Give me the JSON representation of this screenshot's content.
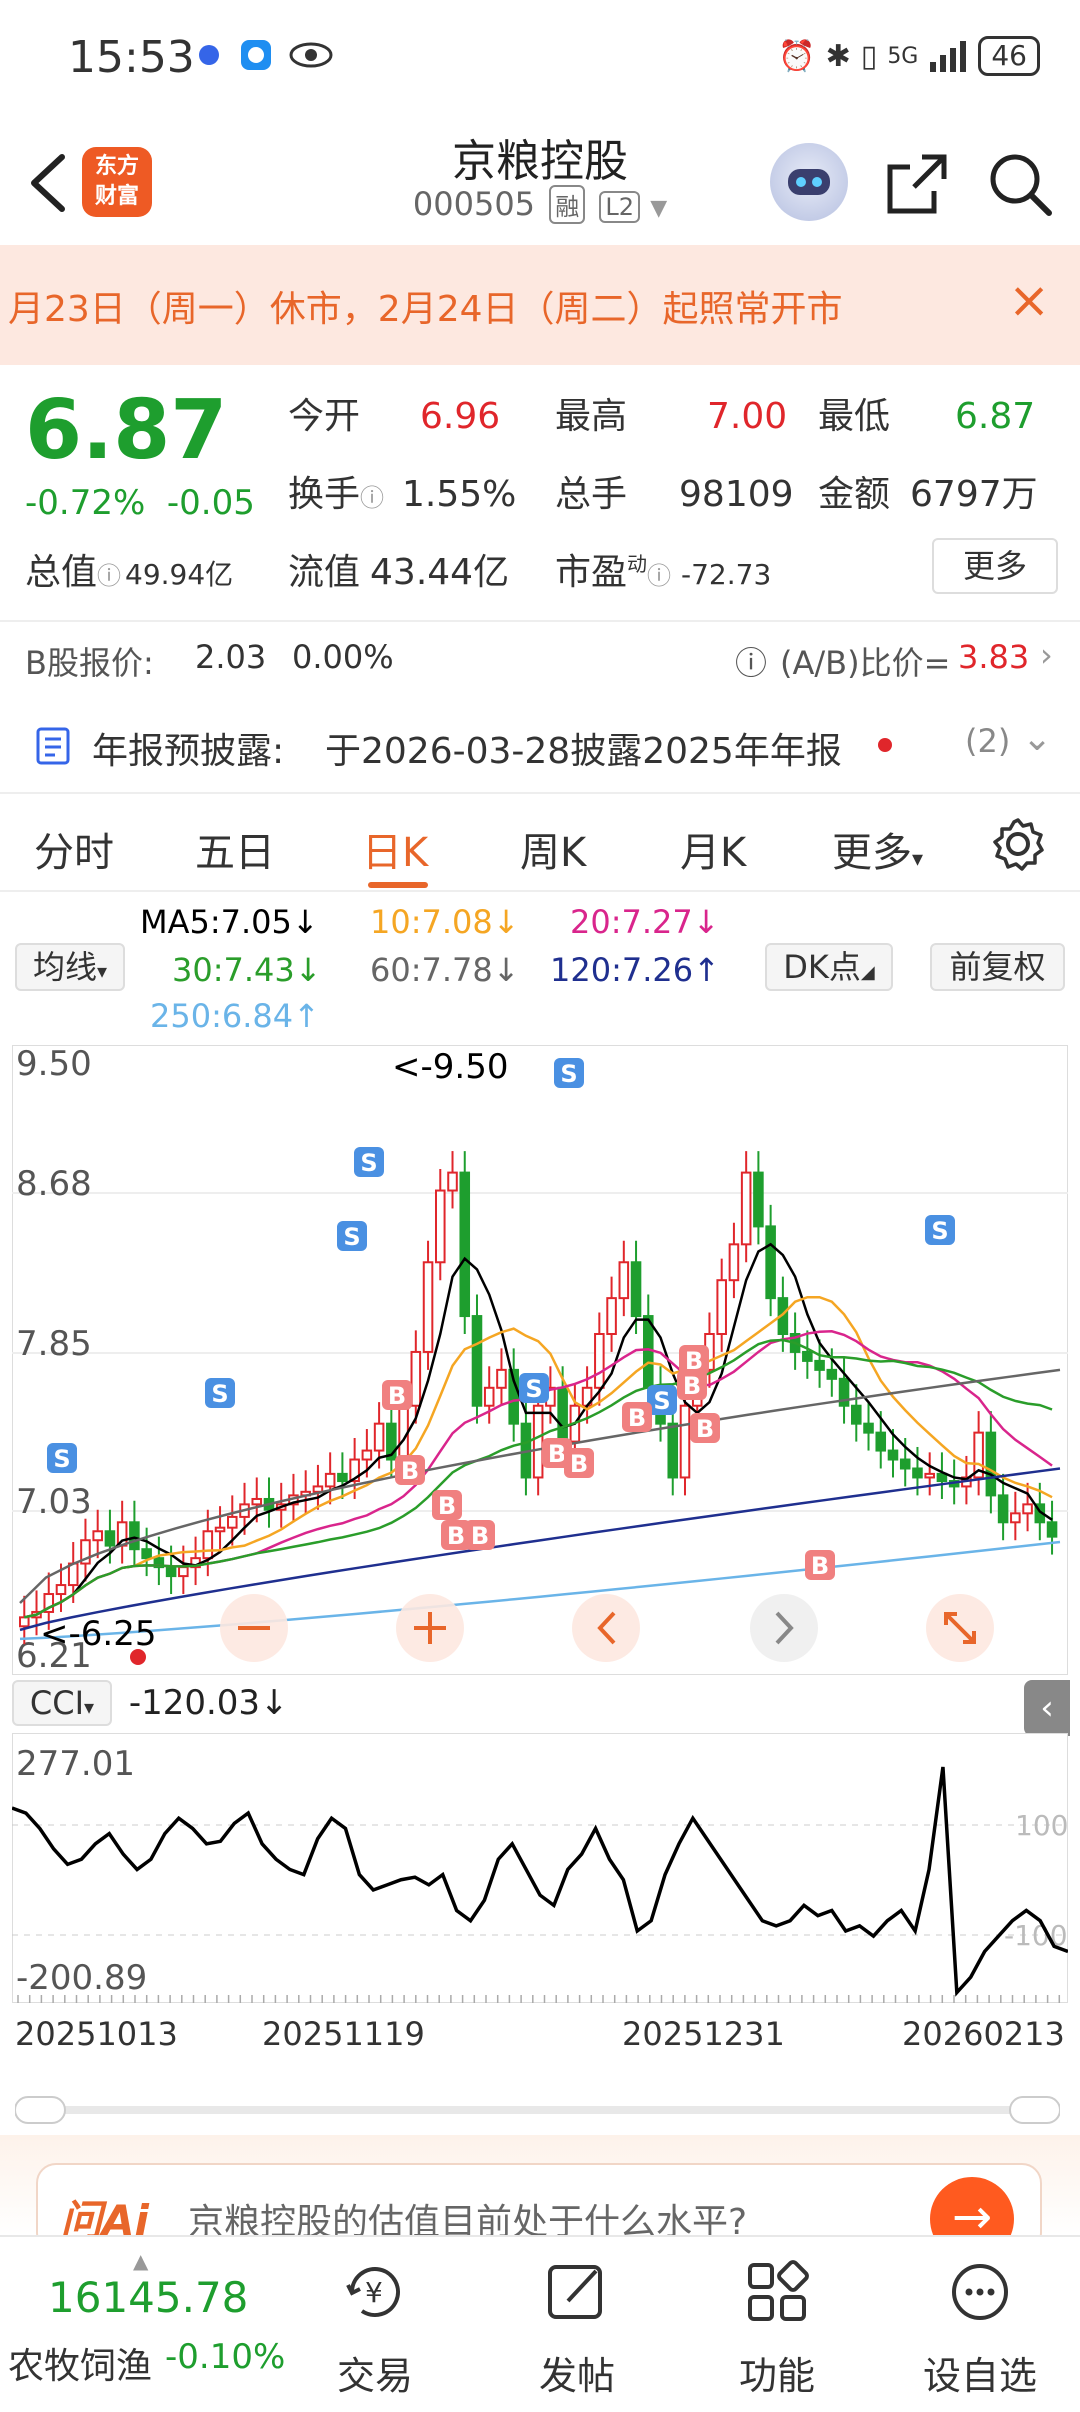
{
  "status": {
    "time": "15:53",
    "network": "5G",
    "battery": "46"
  },
  "header": {
    "logo_line1": "东方",
    "logo_line2": "财富",
    "title": "京粮控股",
    "code": "000505",
    "tag_rong": "融",
    "tag_l2": "L2"
  },
  "notice": {
    "text": "月23日（周一）休市，2月24日（周二）起照常开市",
    "close": "×"
  },
  "quote": {
    "price": "6.87",
    "change_pct": "-0.72%",
    "change": "-0.05",
    "open_label": "今开",
    "open": "6.96",
    "high_label": "最高",
    "high": "7.00",
    "low_label": "最低",
    "low": "6.87",
    "turnover_label": "换手",
    "turnover": "1.55%",
    "volume_label": "总手",
    "volume": "98109",
    "amount_label": "金额",
    "amount": "6797万",
    "mcap_label": "总值",
    "mcap": "49.94亿",
    "float_label": "流值",
    "float": "43.44亿",
    "pe_label": "市盈",
    "pe_sup": "动",
    "pe": "-72.73",
    "more": "更多"
  },
  "bshare": {
    "label": "B股报价:",
    "price": "2.03",
    "pct": "0.00%",
    "ratio_label": "(A/B)比价=",
    "ratio": "3.83"
  },
  "annual": {
    "label": "年报预披露:",
    "text": "于2026-03-28披露2025年年报",
    "count": "(2)"
  },
  "tabs": [
    "分时",
    "五日",
    "日K",
    "周K",
    "月K",
    "更多"
  ],
  "ma": {
    "selector": "均线",
    "ma5": "MA5:7.05↓",
    "ma10": "10:7.08↓",
    "ma20": "20:7.27↓",
    "ma30": "30:7.43↓",
    "ma60": "60:7.78↓",
    "ma120": "120:7.26↑",
    "ma250": "250:6.84↑",
    "dk": "DK点",
    "adjust": "前复权"
  },
  "chart": {
    "y_labels": [
      "9.50",
      "8.68",
      "7.85",
      "7.03",
      "6.21"
    ],
    "max_note": "<-9.50",
    "min_note": "<-6.25",
    "colors": {
      "up": "#e0262b",
      "down": "#1e9e2e",
      "ma5": "#000000",
      "ma10": "#f5a623",
      "ma20": "#d9258c",
      "ma30": "#2a9d2a",
      "ma60": "#666666",
      "ma120": "#1f2f8f",
      "ma250": "#6ab4e8"
    }
  },
  "chart_data": {
    "type": "candlestick",
    "ylim": [
      6.21,
      9.5
    ],
    "y_ticks": [
      9.5,
      8.68,
      7.85,
      7.03,
      6.21
    ],
    "x_ticks": [
      "20251013",
      "20251119",
      "20251231",
      "20260213"
    ],
    "high": 9.5,
    "low": 6.25,
    "last_close": 6.87
  },
  "cci": {
    "selector": "CCI",
    "value": "-120.03↓",
    "top": "277.01",
    "bottom": "-200.89",
    "ref_hi": "100",
    "ref_lo": "-100"
  },
  "dates": [
    "20251013",
    "20251119",
    "20251231",
    "20260213"
  ],
  "ai": {
    "logo": "问Ai",
    "question": "京粮控股的估值目前处于什么水平?"
  },
  "bottom": {
    "index_value": "16145.78",
    "index_name": "农牧饲渔",
    "index_change": "-0.10%",
    "nav": [
      "交易",
      "发帖",
      "功能",
      "设自选"
    ]
  }
}
